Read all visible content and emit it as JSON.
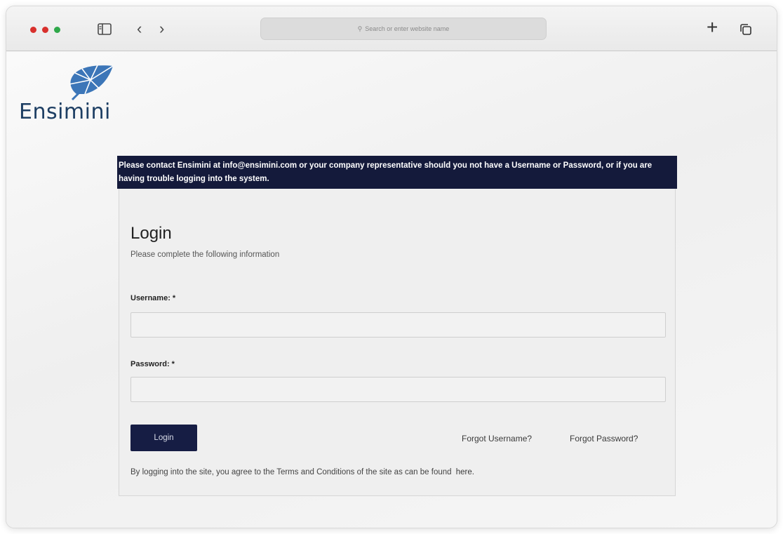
{
  "browser": {
    "address_placeholder": "Search or enter website name"
  },
  "brand": {
    "name": "Ensimini",
    "logo_color": "#2f6aa8"
  },
  "notice": {
    "text": "Please contact Ensimini at info@ensimini.com or your company representative should you not have a Username or Password, or if you are having trouble logging into the system.",
    "background": "#141a3b"
  },
  "login": {
    "title": "Login",
    "subtitle": "Please complete the following information",
    "username_label": "Username: *",
    "username_value": "",
    "password_label": "Password: *",
    "password_value": "",
    "button_label": "Login",
    "forgot_username": "Forgot Username?",
    "forgot_password": "Forgot Password?",
    "terms_text": "By logging into the site, you agree to the Terms and Conditions of the site as can be found",
    "terms_link": "here.",
    "accent": "#161d44"
  },
  "icons": {
    "sidebar": "sidebar-icon",
    "back": "chevron-left-icon",
    "forward": "chevron-right-icon",
    "search": "search-icon",
    "new_tab": "plus-icon",
    "tabs": "tab-overview-icon"
  }
}
